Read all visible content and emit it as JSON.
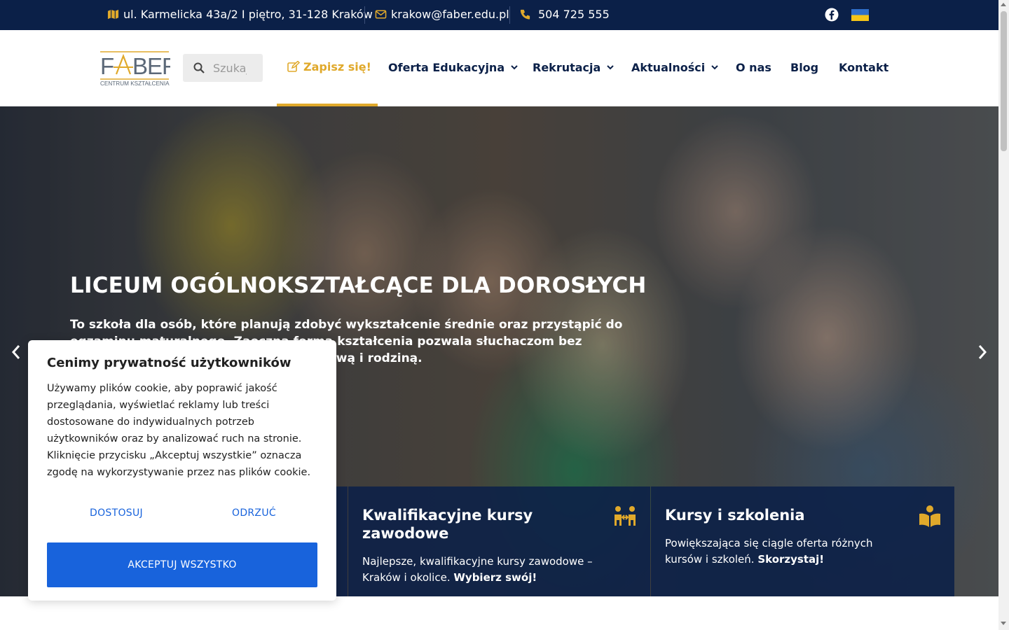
{
  "topbar": {
    "address": "ul. Karmelicka 43a/2 I piętro, 31-128 Kraków",
    "email": "krakow@faber.edu.pl",
    "phone": "504 725 555",
    "address_icon": "map-icon",
    "email_icon": "envelope-icon",
    "phone_icon": "phone-icon",
    "social_icon": "facebook-icon",
    "flag_icon": "ukraine-flag-icon"
  },
  "header": {
    "logo_text": "FABER",
    "logo_sub": "CENTRUM KSZTAŁCENIA",
    "search_placeholder": "Szukaj",
    "nav": {
      "enroll": "Zapisz się!",
      "offer": "Oferta Edukacyjna",
      "recruitment": "Rekrutacja",
      "news": "Aktualności",
      "about": "O nas",
      "blog": "Blog",
      "contact": "Kontakt"
    }
  },
  "hero": {
    "title": "LICEUM OGÓLNOKSZTAŁCĄCE DLA DOROSŁYCH",
    "text": "To szkoła dla osób, które planują zdobyć wykształcenie średnie oraz przystąpić do egzaminu maturalnego. Zaoczna forma kształcenia pozwala słuchaczom bez przeszkód łączyć naukę z pracą zawodową i rodziną."
  },
  "cards": [
    {
      "title": "Kwalifikacyjne kursy zawodowe",
      "text": "Najlepsze, kwalifikacyjne kursy zawodowe – Kraków i okolice.",
      "cta": "Wybierz swój!"
    },
    {
      "title": "Kursy i szkolenia",
      "text": "Powiększająca się ciągle oferta różnych kursów i szkoleń.",
      "cta": "Skorzystaj!"
    }
  ],
  "cookie": {
    "title": "Cenimy prywatność użytkowników",
    "body": "Używamy plików cookie, aby poprawić jakość przeglądania, wyświetlać reklamy lub treści dostosowane do indywidualnych potrzeb użytkowników oraz by analizować ruch na stronie. Kliknięcie przycisku „Akceptuj wszystkie” oznacza zgodę na wykorzystywanie przez nas plików cookie.",
    "customize": "DOSTOSUJ",
    "reject": "ODRZUĆ",
    "accept": "AKCEPTUJ WSZYSTKO"
  },
  "colors": {
    "navy": "#0b2048",
    "gold": "#e0a92b",
    "cookie_blue": "#1863dc"
  }
}
